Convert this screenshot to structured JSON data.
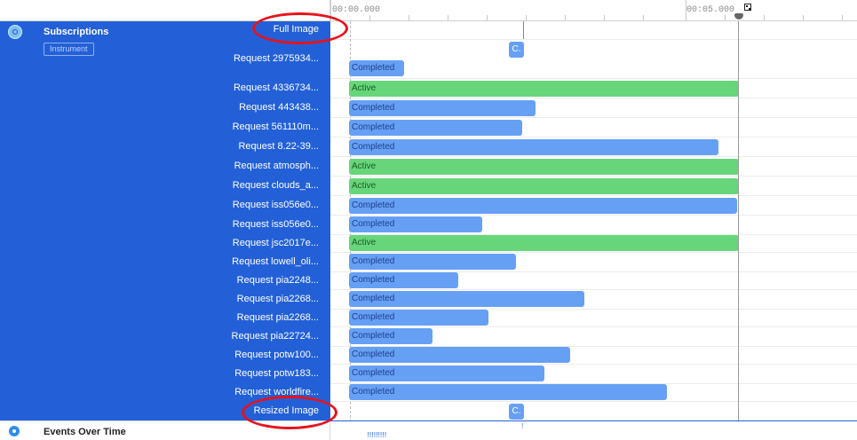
{
  "ruler": {
    "start_label": "00:00.000",
    "mid_label": "00:05.000"
  },
  "instrument": {
    "title": "Subscriptions",
    "badge": "Instrument",
    "icon": "subscriptions-instrument-icon"
  },
  "rows": [
    {
      "label": "Full Image",
      "status": "",
      "annotated": true
    },
    {
      "label": "Request 2975934...",
      "status": "Completed"
    },
    {
      "label": "Request 4336734...",
      "status": "Active"
    },
    {
      "label": "Request 443438...",
      "status": "Completed"
    },
    {
      "label": "Request 561110m...",
      "status": "Completed"
    },
    {
      "label": "Request 8.22-39...",
      "status": "Completed"
    },
    {
      "label": "Request atmosph...",
      "status": "Active"
    },
    {
      "label": "Request clouds_a...",
      "status": "Active"
    },
    {
      "label": "Request iss056e0...",
      "status": "Completed"
    },
    {
      "label": "Request iss056e0...",
      "status": "Completed"
    },
    {
      "label": "Request jsc2017e...",
      "status": "Active"
    },
    {
      "label": "Request lowell_oli...",
      "status": "Completed"
    },
    {
      "label": "Request pia2248...",
      "status": "Completed"
    },
    {
      "label": "Request pia2268...",
      "status": "Completed"
    },
    {
      "label": "Request pia2268...",
      "status": "Completed"
    },
    {
      "label": "Request pia22724...",
      "status": "Completed"
    },
    {
      "label": "Request potw100...",
      "status": "Completed"
    },
    {
      "label": "Request potw183...",
      "status": "Completed"
    },
    {
      "label": "Request worldfire...",
      "status": "Completed"
    },
    {
      "label": "Resized Image",
      "status": "",
      "annotated": true
    }
  ],
  "markers": {
    "full_image_marker": "C.",
    "resized_image_marker": "C."
  },
  "events": {
    "title": "Events Over Time",
    "icon": "pin-icon",
    "ticks": "!!!!!!!!!"
  },
  "colors": {
    "sidebar": "#2360d8",
    "completed": "#66a0f5",
    "active": "#67d67a",
    "annotation": "#e8121a"
  }
}
